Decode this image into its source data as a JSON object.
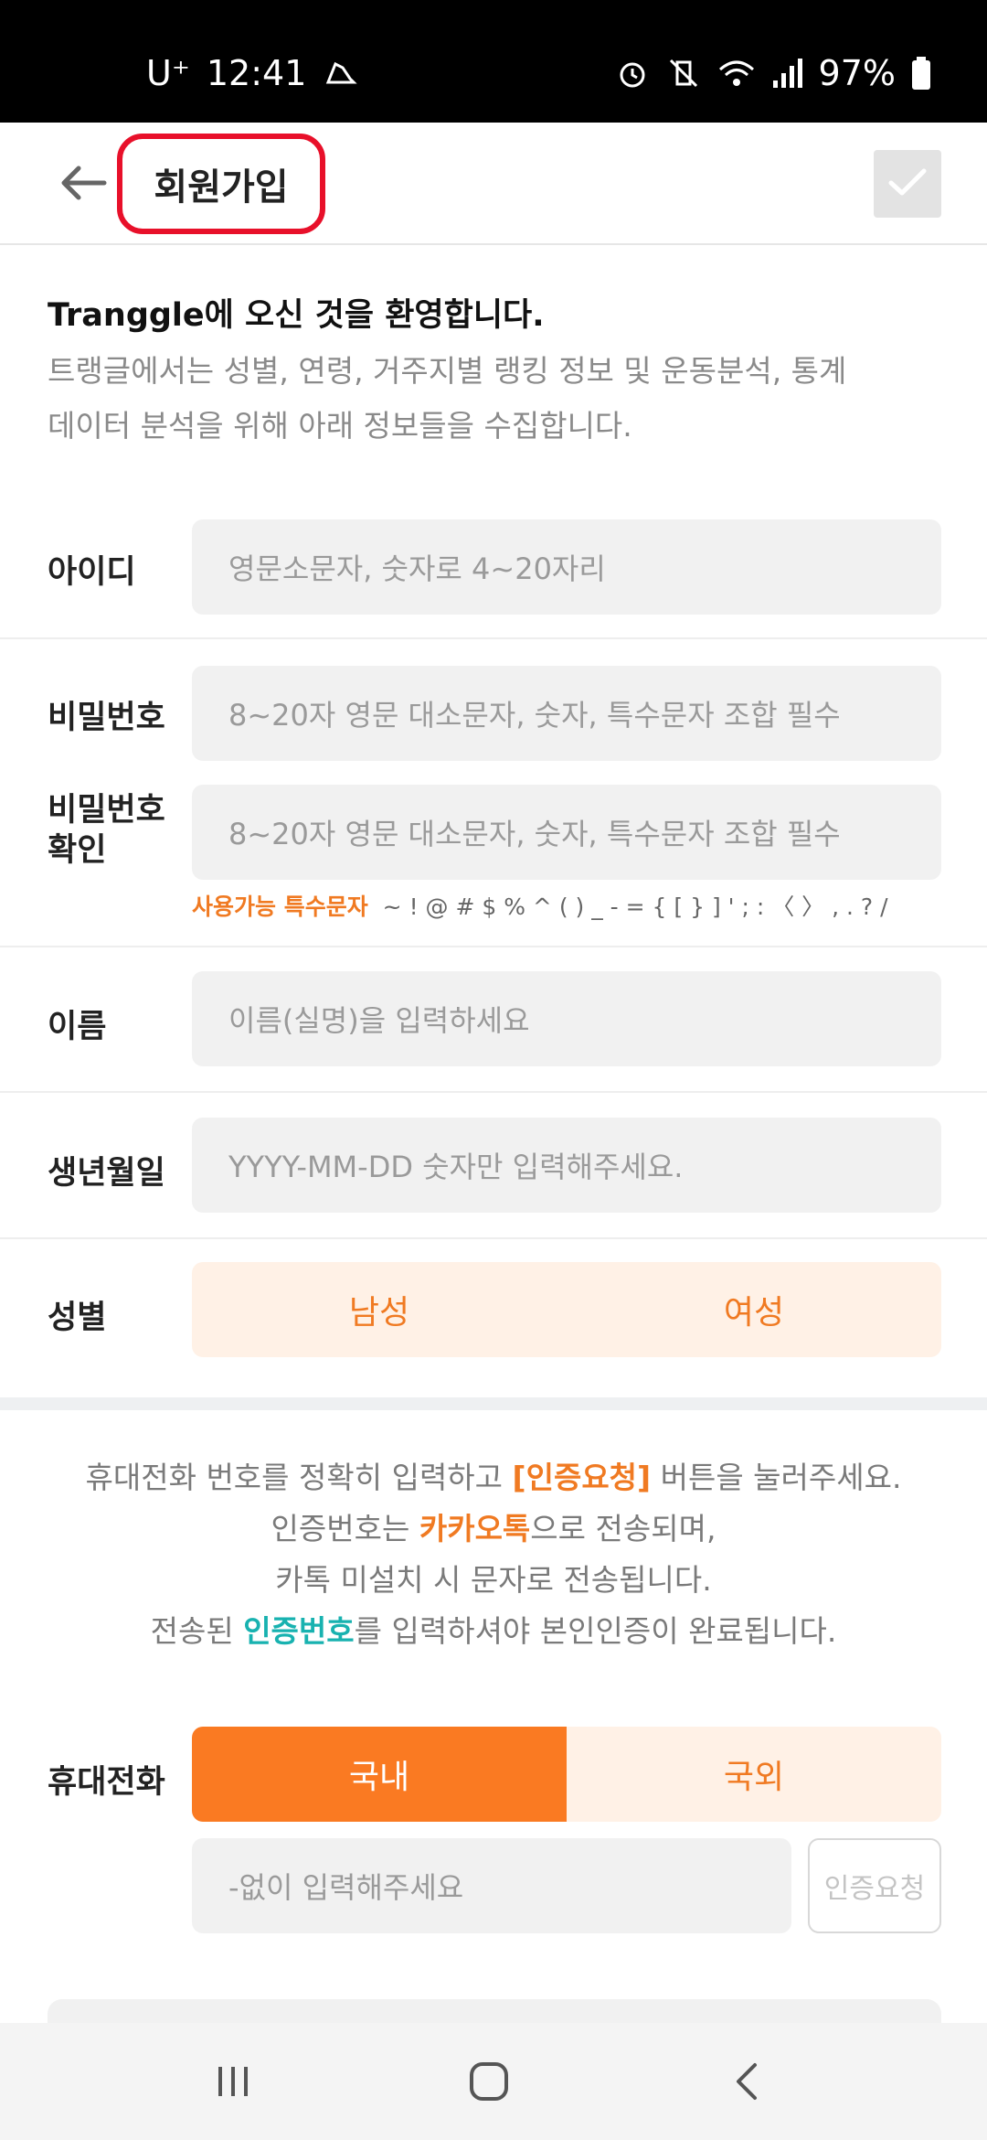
{
  "status_bar": {
    "carrier": "U⁺",
    "time": "12:41",
    "battery": "97%",
    "icons": [
      "shoe-icon",
      "alarm-icon",
      "vibrate-mute-icon",
      "wifi-icon",
      "signal-icon",
      "battery-icon"
    ]
  },
  "header": {
    "back_icon": "arrow-left-icon",
    "title": "회원가입",
    "confirm_icon": "check-icon"
  },
  "intro": {
    "welcome": "Tranggle에 오신 것을 환영합니다.",
    "description_line1": "트랭글에서는 성별, 연령, 거주지별 랭킹 정보 및 운동분석, 통계",
    "description_line2": "데이터 분석을 위해 아래 정보들을 수집합니다."
  },
  "form": {
    "id_label": "아이디",
    "id_placeholder": "영문소문자, 숫자로 4~20자리",
    "password_label": "비밀번호",
    "password_placeholder": "8~20자 영문 대소문자, 숫자, 특수문자 조합 필수",
    "password_confirm_label_line1": "비밀번호",
    "password_confirm_label_line2": "확인",
    "password_confirm_placeholder": "8~20자 영문 대소문자, 숫자, 특수문자 조합 필수",
    "special_chars_label": "사용가능 특수문자",
    "special_chars": "~ ! @ # $ % ^ ( ) _ - = { [ } ] ' ; : 〈 〉 , . ? /",
    "name_label": "이름",
    "name_placeholder": "이름(실명)을 입력하세요",
    "birth_label": "생년월일",
    "birth_placeholder": "YYYY-MM-DD 숫자만 입력해주세요.",
    "gender_label": "성별",
    "gender_male": "남성",
    "gender_female": "여성"
  },
  "notice": {
    "line1_a": "휴대전화 번호를 정확히 입력하고 ",
    "line1_highlight": "[인증요청]",
    "line1_b": " 버튼을 눌러주세요.",
    "line2_a": "인증번호는 ",
    "line2_highlight": "카카오톡",
    "line2_b": "으로 전송되며,",
    "line3": "카톡 미설치 시 문자로 전송됩니다.",
    "line4_a": "전송된 ",
    "line4_highlight": "인증번호",
    "line4_b": "를 입력하셔야 본인인증이 완료됩니다."
  },
  "phone": {
    "label": "휴대전화",
    "tab_domestic": "국내",
    "tab_foreign": "국외",
    "selected_tab": "국내",
    "input_placeholder": "-없이 입력해주세요",
    "verify_button": "인증요청"
  },
  "colors": {
    "accent_orange": "#fa7a22",
    "soft_orange_bg": "#fff1e6",
    "teal_highlight": "#18b2b0",
    "title_highlight_red": "#e8102a"
  }
}
